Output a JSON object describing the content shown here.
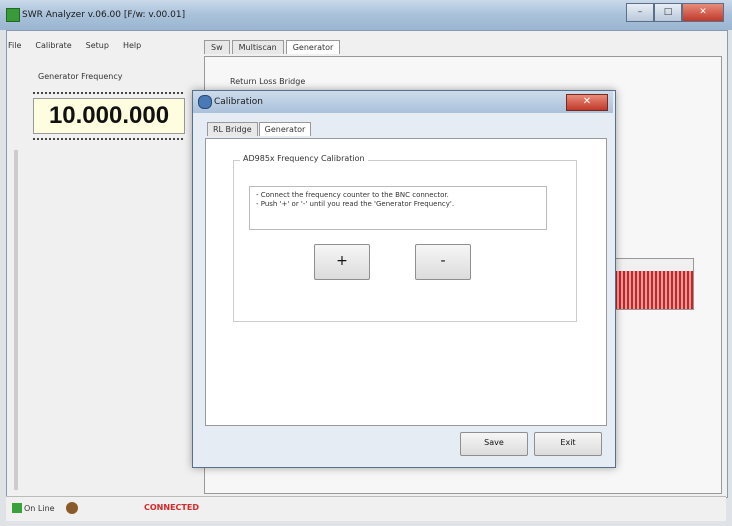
{
  "window": {
    "title": "SWR Analyzer v.06.00 [F/w: v.00.01]",
    "minimize": "–",
    "maximize": "□",
    "close": "✕"
  },
  "menu": [
    "File",
    "Calibrate",
    "Setup",
    "Help"
  ],
  "generator": {
    "label": "Generator Frequency",
    "value": "10.000.000"
  },
  "main_tabs": [
    "Sw",
    "Multiscan",
    "Generator"
  ],
  "main_panel": {
    "section_label": "Return Loss Bridge"
  },
  "dialog": {
    "title": "Calibration",
    "close": "✕",
    "tabs": [
      "RL Bridge",
      "Generator"
    ],
    "active_tab": "Generator",
    "group_label": "AD985x Frequency Calibration",
    "instructions": [
      "- Connect the frequency counter to the BNC connector.",
      "- Push '+' or '-' until you read the 'Generator Frequency'."
    ],
    "plus_label": "+",
    "minus_label": "-",
    "save_label": "Save",
    "exit_label": "Exit"
  },
  "status": {
    "online": "On Line",
    "connection": "CONNECTED"
  },
  "colors": {
    "connected": "#d62828",
    "freq_bg": "#fffde0"
  }
}
